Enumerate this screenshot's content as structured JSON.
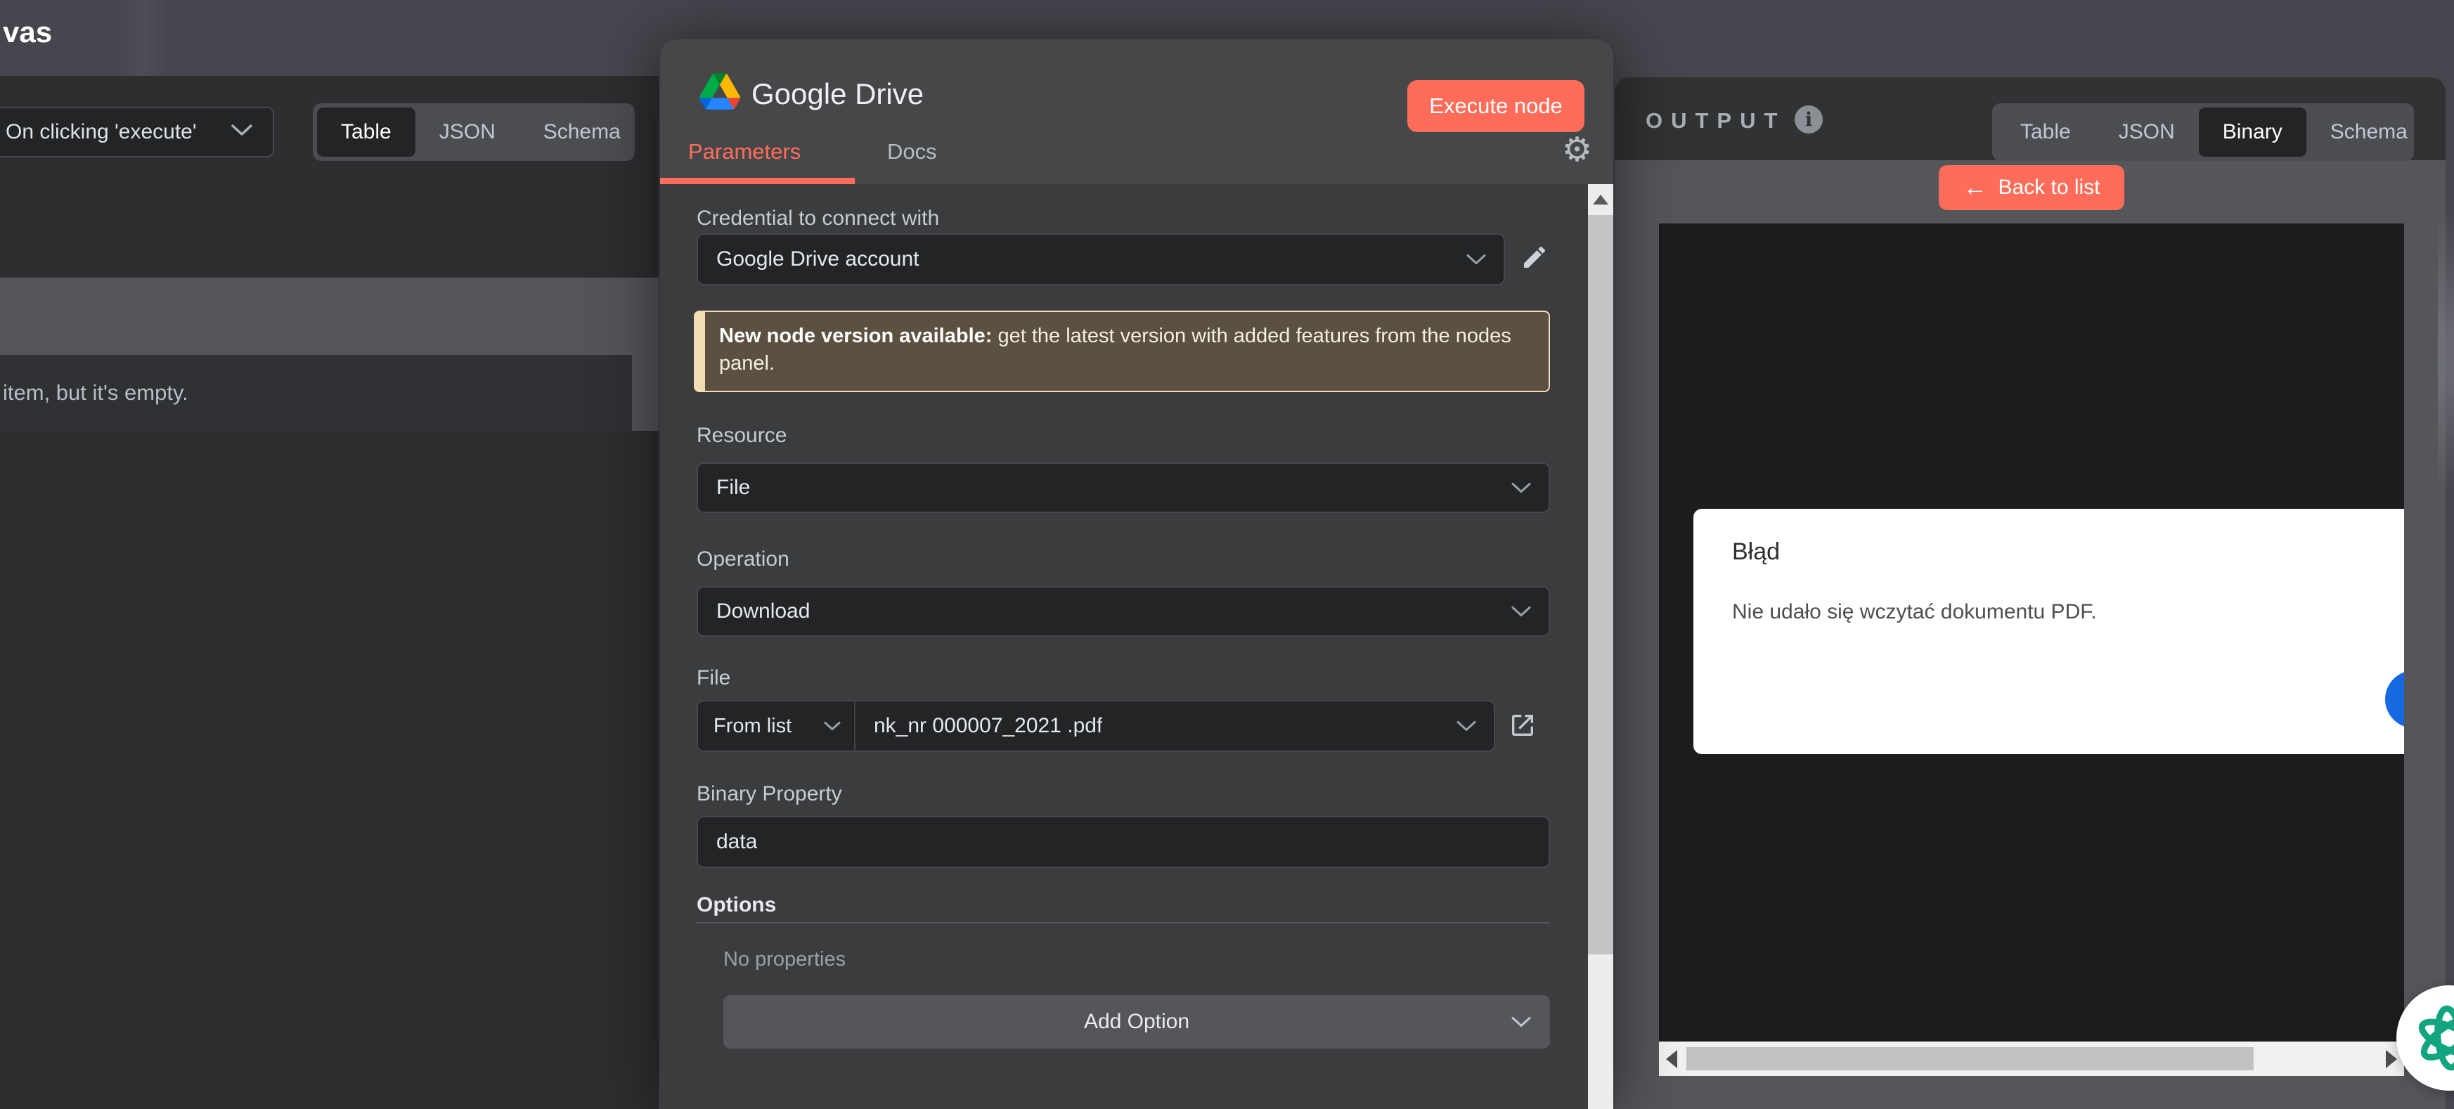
{
  "topbar": {
    "canvas_tail": "vas"
  },
  "input_panel": {
    "run_selector_value": "On clicking 'execute'",
    "view_tabs": [
      "Table",
      "JSON",
      "Schema"
    ],
    "active_view_tab": "Table",
    "empty_text": "item, but it's empty."
  },
  "modal": {
    "title": "Google Drive",
    "execute_button": "Execute node",
    "tabs": [
      "Parameters",
      "Docs"
    ],
    "active_tab": "Parameters",
    "credential": {
      "label": "Credential to connect with",
      "value": "Google Drive account"
    },
    "notice": {
      "bold": "New node version available:",
      "text": " get the latest version with added features from the nodes panel."
    },
    "resource": {
      "label": "Resource",
      "value": "File"
    },
    "operation": {
      "label": "Operation",
      "value": "Download"
    },
    "file": {
      "label": "File",
      "mode": "From list",
      "value": "nk_nr 000007_2021 .pdf"
    },
    "binary_property": {
      "label": "Binary Property",
      "value": "data"
    },
    "options": {
      "label": "Options",
      "empty": "No properties",
      "add_button": "Add Option"
    }
  },
  "output_panel": {
    "title": "OUTPUT",
    "tabs": [
      "Table",
      "JSON",
      "Binary",
      "Schema"
    ],
    "active_tab": "Binary",
    "back_button": "Back to list",
    "error": {
      "title": "Błąd",
      "message": "Nie udało się wczytać dokumentu PDF."
    }
  },
  "colors": {
    "accent_orange": "#ff6d5a",
    "canvas_bg": "#46464e",
    "modal_header_bg": "#464749",
    "modal_body_bg": "#3b3c3e",
    "field_bg": "#232425",
    "warning_bg": "#5c5140",
    "warning_border": "#f2ddb4",
    "output_header_bg": "#313233",
    "output_body_bg": "#55565a",
    "pdf_viewer_bg": "#1c1d1f",
    "error_card_bg": "#ffffff",
    "fab_blue": "#1669e0",
    "atom_green": "#12a57f"
  }
}
